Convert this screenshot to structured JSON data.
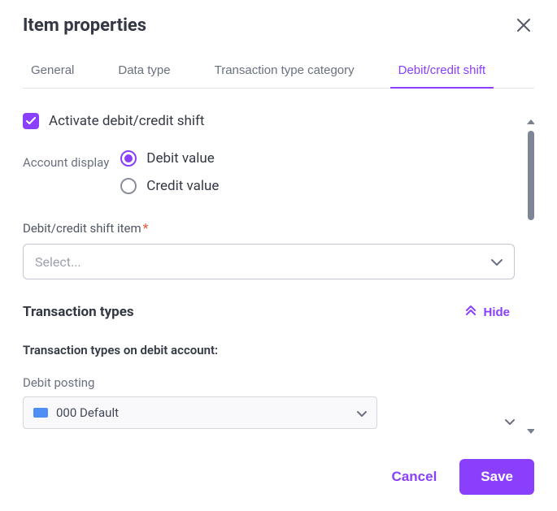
{
  "header": {
    "title": "Item properties"
  },
  "tabs": [
    {
      "label": "General",
      "active": false
    },
    {
      "label": "Data type",
      "active": false
    },
    {
      "label": "Transaction type category",
      "active": false
    },
    {
      "label": "Debit/credit shift",
      "active": true
    }
  ],
  "activate": {
    "label": "Activate debit/credit shift",
    "checked": true
  },
  "account_display": {
    "label": "Account display",
    "options": {
      "debit": "Debit value",
      "credit": "Credit value"
    },
    "selected": "debit"
  },
  "shift_item": {
    "label": "Debit/credit shift item",
    "required": "*",
    "placeholder": "Select..."
  },
  "transaction_types": {
    "title": "Transaction types",
    "hide_label": "Hide",
    "debit_account_label": "Transaction types on debit account:",
    "debit_posting": {
      "label": "Debit posting",
      "value": "000 Default"
    }
  },
  "footer": {
    "cancel": "Cancel",
    "save": "Save"
  }
}
